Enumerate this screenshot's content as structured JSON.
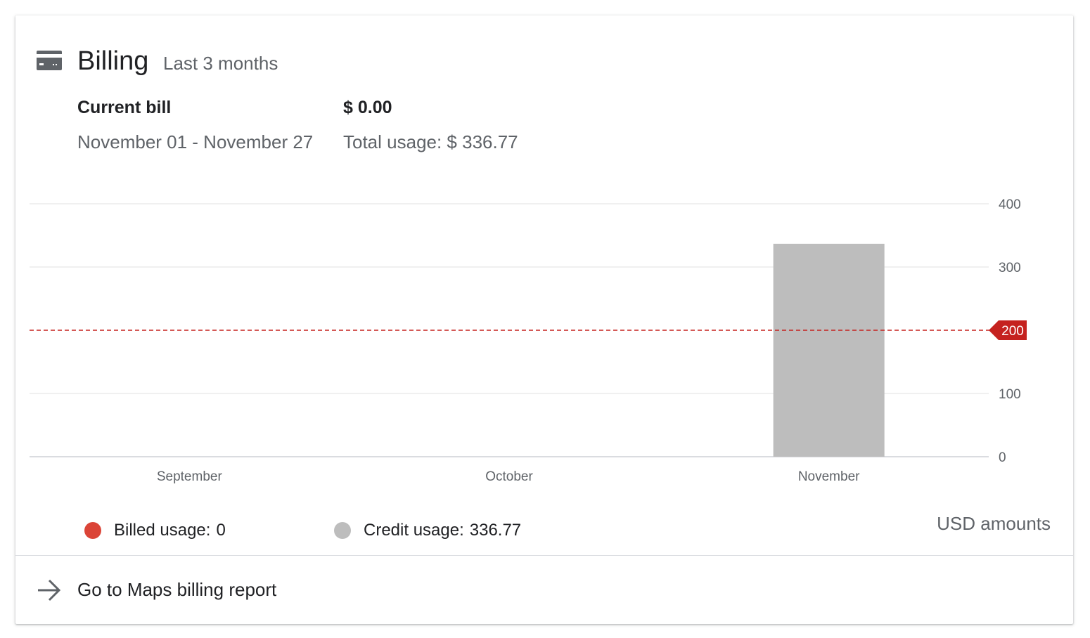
{
  "card": {
    "title": "Billing",
    "subtitle": "Last 3 months",
    "header_icon": "credit-card-icon"
  },
  "summary": {
    "current_bill_label": "Current bill",
    "current_bill_amount": "$ 0.00",
    "period": "November 01 - November 27",
    "total_usage": "Total usage: $ 336.77"
  },
  "chart_data": {
    "type": "bar",
    "categories": [
      "September",
      "October",
      "November"
    ],
    "series": [
      {
        "name": "Billed usage",
        "values": [
          0,
          0,
          0
        ],
        "color": "#db4437"
      },
      {
        "name": "Credit usage",
        "values": [
          0,
          0,
          336.77
        ],
        "color": "#bdbdbd"
      }
    ],
    "yticks": [
      0,
      100,
      200,
      300,
      400
    ],
    "ylim": [
      0,
      400
    ],
    "threshold": {
      "value": 200,
      "label": "200",
      "color": "#c5221f"
    },
    "grid": true
  },
  "legend": [
    {
      "label": "Billed usage:",
      "value": "0",
      "color": "#db4437"
    },
    {
      "label": "Credit usage:",
      "value": "336.77",
      "color": "#bdbdbd"
    }
  ],
  "units_label": "USD amounts",
  "footer": {
    "link_label": "Go to Maps billing report",
    "icon": "arrow-right-icon"
  }
}
